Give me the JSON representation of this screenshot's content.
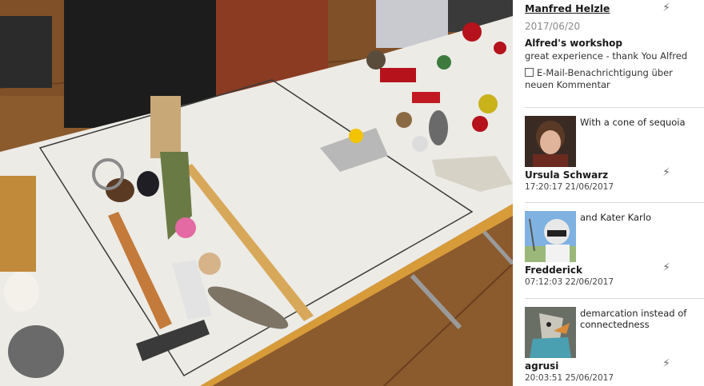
{
  "post": {
    "author": "Manfred Helzle",
    "date": "2017/06/20",
    "title": "Alfred's workshop",
    "text": "great experience - thank You Alfred",
    "notify_label": "E-Mail-Benachrichtigung über neuen Kommentar",
    "action_icon": "flash-icon"
  },
  "comments": [
    {
      "text": "With a cone of sequoia",
      "author": "Ursula Schwarz",
      "time": "17:20:17 21/06/2017"
    },
    {
      "text": "and Kater Karlo",
      "author": "Fredderick",
      "time": "07:12:03 22/06/2017"
    },
    {
      "text": "demarcation instead of connectedness",
      "author": "agrusi",
      "time": "20:03:51 25/06/2017"
    }
  ],
  "icons": {
    "action": "⚡"
  },
  "colors": {
    "table_paper": "#ecebe6",
    "floor": "#8a5a2e",
    "divider": "#d9d9d9"
  }
}
